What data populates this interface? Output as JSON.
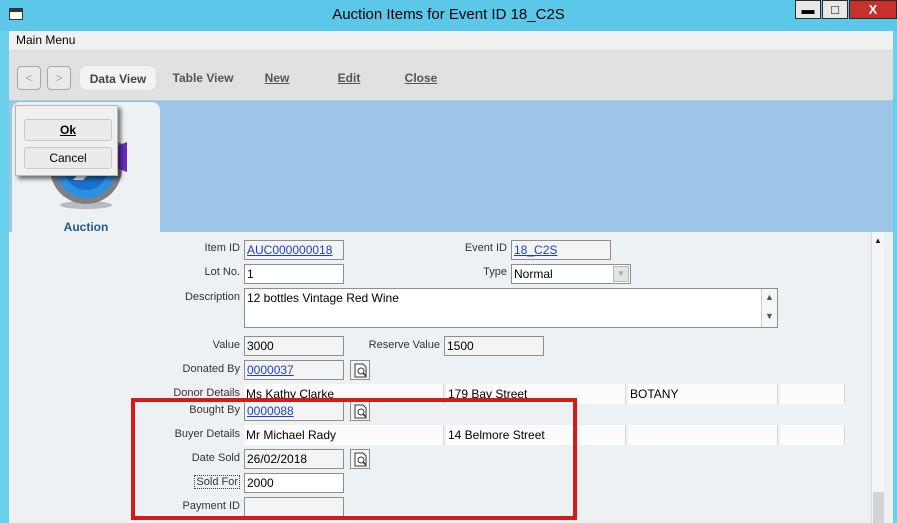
{
  "window": {
    "title": "Auction Items for Event ID 18_C2S",
    "minimize": "▬",
    "maximize": "□",
    "close": "X"
  },
  "menu": {
    "main_menu": "Main Menu"
  },
  "toolbar": {
    "back": "<",
    "forward": ">",
    "data_view": "Data View",
    "table_view": "Table View",
    "new": "New",
    "edit": "Edit",
    "close": "Close"
  },
  "tab": {
    "label": "Auction"
  },
  "popup": {
    "ok": "Ok",
    "cancel": "Cancel"
  },
  "form": {
    "item_id": {
      "label": "Item ID",
      "value": "AUC000000018"
    },
    "event_id": {
      "label": "Event ID",
      "value": "18_C2S"
    },
    "lot_no": {
      "label": "Lot No.",
      "value": "1"
    },
    "type": {
      "label": "Type",
      "value": "Normal"
    },
    "description": {
      "label": "Description",
      "value": "12 bottles Vintage Red Wine"
    },
    "value": {
      "label": "Value",
      "value": "3000"
    },
    "reserve_value": {
      "label": "Reserve Value",
      "value": "1500"
    },
    "donated_by": {
      "label": "Donated By",
      "value": "0000037"
    },
    "donor_details": {
      "label": "Donor Details",
      "name": "Ms Kathy Clarke",
      "street": "179 Bay Street",
      "suburb": "BOTANY",
      "extra": ""
    },
    "bought_by": {
      "label": "Bought By",
      "value": "0000088"
    },
    "buyer_details": {
      "label": "Buyer Details",
      "name": "Mr Michael Rady",
      "street": "14 Belmore Street",
      "suburb": "",
      "extra": ""
    },
    "date_sold": {
      "label": "Date Sold",
      "value": "26/02/2018"
    },
    "sold_for": {
      "label": "Sold For",
      "value": "2000"
    },
    "payment_id": {
      "label": "Payment ID",
      "value": ""
    }
  },
  "colors": {
    "titlebar": "#5bc8ea",
    "banner": "#9ec5e8",
    "link": "#1d3fd1",
    "highlight": "#d51a1a"
  },
  "icons": [
    "window-menu-icon",
    "lookup-icon",
    "dropdown-arrow-icon",
    "scroll-up-icon",
    "scroll-down-icon",
    "auction-logo-icon"
  ]
}
